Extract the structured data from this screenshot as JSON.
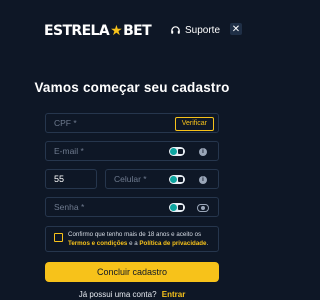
{
  "brand": {
    "part1": "ESTRELA",
    "part2": "BET",
    "accent": "#f7c21a"
  },
  "header": {
    "support_label": "Suporte",
    "close_symbol": "✕"
  },
  "form": {
    "title": "Vamos começar seu cadastro",
    "cpf": {
      "placeholder": "CPF *",
      "verify_label": "Verificar"
    },
    "email": {
      "placeholder": "E-mail *"
    },
    "phone": {
      "country_code": "55",
      "placeholder": "Celular *"
    },
    "password": {
      "placeholder": "Senha *"
    },
    "consent": {
      "text_prefix": "Confirmo que tenho mais de 18 anos e aceito os ",
      "terms_link": "Termos e condições",
      "text_middle": " e a ",
      "privacy_link": "Política de privacidade",
      "text_suffix": "."
    },
    "submit_label": "Concluir cadastro",
    "login_prompt": "Já possui uma conta?",
    "login_link": "Entrar"
  },
  "colors": {
    "background": "#0e1726",
    "border": "#26364d",
    "accent": "#f7c21a"
  },
  "icons": [
    "headset-icon",
    "close-icon",
    "autofill-toggle-icon",
    "info-icon",
    "eye-icon"
  ]
}
